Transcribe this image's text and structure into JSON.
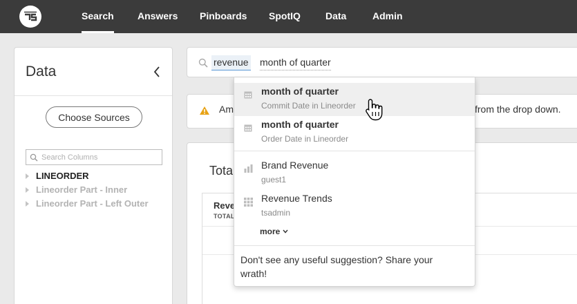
{
  "nav": {
    "logo": "ts-logo",
    "items": [
      {
        "label": "Search",
        "active": true
      },
      {
        "label": "Answers",
        "active": false
      },
      {
        "label": "Pinboards",
        "active": false
      },
      {
        "label": "SpotIQ",
        "active": false
      },
      {
        "label": "Data",
        "active": false
      },
      {
        "label": "Admin",
        "active": false
      }
    ]
  },
  "data_panel": {
    "title": "Data",
    "collapse_icon": "chevron-left-icon",
    "choose_sources_label": "Choose Sources",
    "search_placeholder": "Search Columns",
    "sources": [
      {
        "label": "LINEORDER",
        "state": "selected"
      },
      {
        "label": "Lineorder Part - Inner",
        "state": "disabled"
      },
      {
        "label": "Lineorder Part - Left Outer",
        "state": "disabled"
      }
    ]
  },
  "search": {
    "token": "revenue",
    "query": "month of quarter"
  },
  "warning": {
    "icon": "warning-triangle-icon",
    "text_start": "Am",
    "text_end": "from the drop down."
  },
  "result": {
    "title": "Tota",
    "column_header": "Reve",
    "column_sub": "TOTAL"
  },
  "dropdown": {
    "suggestions": [
      {
        "icon": "calendar-icon",
        "title": "month of quarter",
        "subtitle": "Commit Date in Lineorder",
        "bold": true,
        "hovered": true
      },
      {
        "icon": "calendar-icon",
        "title": "month of quarter",
        "subtitle": "Order Date in Lineorder",
        "bold": true,
        "hovered": false
      },
      {
        "icon": "bar-chart-icon",
        "title": "Brand Revenue",
        "subtitle": "guest1",
        "bold": false,
        "hovered": false
      },
      {
        "icon": "grid-table-icon",
        "title": "Revenue Trends",
        "subtitle": "tsadmin",
        "bold": false,
        "hovered": false
      }
    ],
    "more_label": "more",
    "footer": "Don't see any useful suggestion? Share your wrath!"
  },
  "colors": {
    "topbar": "#3b3b3b",
    "token_bg": "#ebf1f7",
    "token_underline": "#5a98d6",
    "warning": "#e8a317",
    "hover_row": "#efefef"
  }
}
